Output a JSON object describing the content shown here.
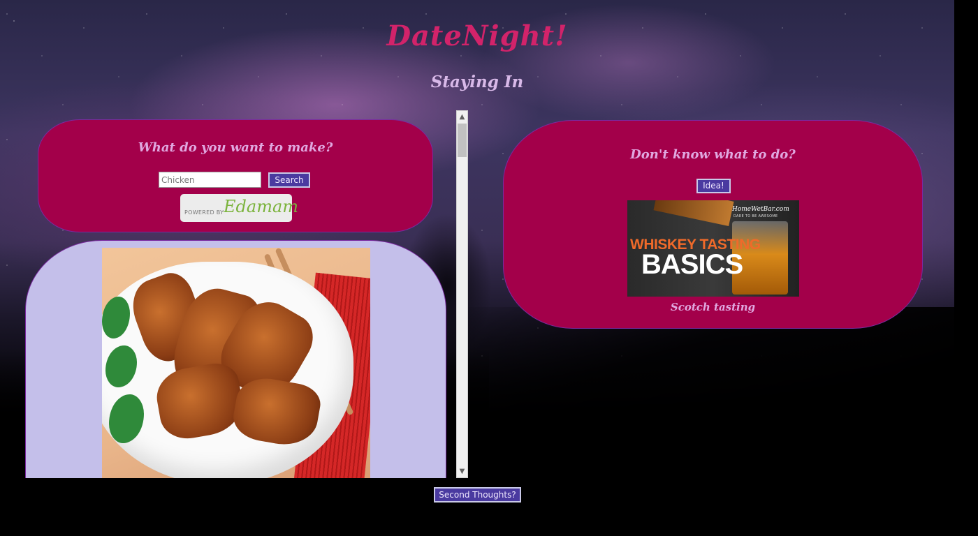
{
  "header": {
    "app_title": "DateNight!",
    "subtitle": "Staying In"
  },
  "search_panel": {
    "heading": "What do you want to make?",
    "input_value": "Chicken",
    "search_label": "Search",
    "powered_by": "POWERED BY",
    "provider": "Edamam"
  },
  "idea_panel": {
    "heading": "Don't know what to do?",
    "idea_label": "Idea!",
    "image_text_line1": "WHISKEY TASTING",
    "image_text_line2": "BASICS",
    "image_brand": "HomeWetBar.com",
    "image_tagline": "DARE TO BE AWESOME",
    "caption": "Scotch tasting"
  },
  "footer": {
    "second_thoughts_label": "Second Thoughts?"
  },
  "colors": {
    "title": "#d2236a",
    "panel": "#a3004a",
    "recipe_panel": "#c4bfea",
    "button": "#4a3aa0"
  }
}
